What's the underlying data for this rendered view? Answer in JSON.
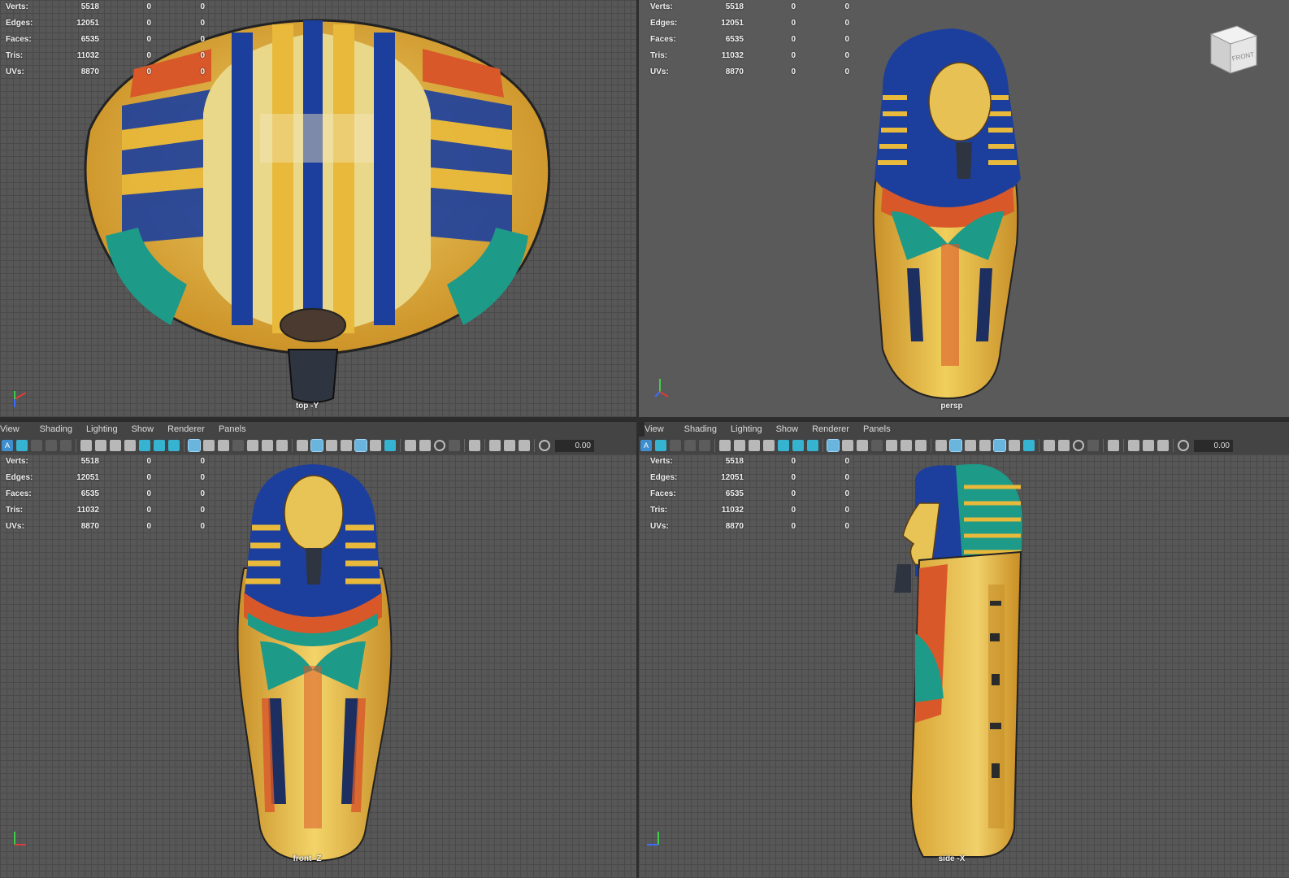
{
  "panels": {
    "top": {
      "camera": "top -Y"
    },
    "persp": {
      "camera": "persp"
    },
    "front": {
      "camera": "front -Z"
    },
    "side": {
      "camera": "side -X"
    }
  },
  "hud_stats": [
    {
      "label": "Verts:",
      "v1": "5518",
      "v2": "0",
      "v3": "0"
    },
    {
      "label": "Edges:",
      "v1": "12051",
      "v2": "0",
      "v3": "0"
    },
    {
      "label": "Faces:",
      "v1": "6535",
      "v2": "0",
      "v3": "0"
    },
    {
      "label": "Tris:",
      "v1": "11032",
      "v2": "0",
      "v3": "0"
    },
    {
      "label": "UVs:",
      "v1": "8870",
      "v2": "0",
      "v3": "0"
    }
  ],
  "menu": {
    "view": "View",
    "shading": "Shading",
    "lighting": "Lighting",
    "show": "Show",
    "renderer": "Renderer",
    "panels": "Panels"
  },
  "toolbar": {
    "value": "0.00",
    "select_glyph": "A"
  },
  "view_cube": {
    "label": "FRONT"
  },
  "colors": {
    "gold": "#e8b93a",
    "blue": "#1c3f9e",
    "teal": "#1d9a88",
    "orange": "#d8582a",
    "viewport_bg": "#575757"
  }
}
